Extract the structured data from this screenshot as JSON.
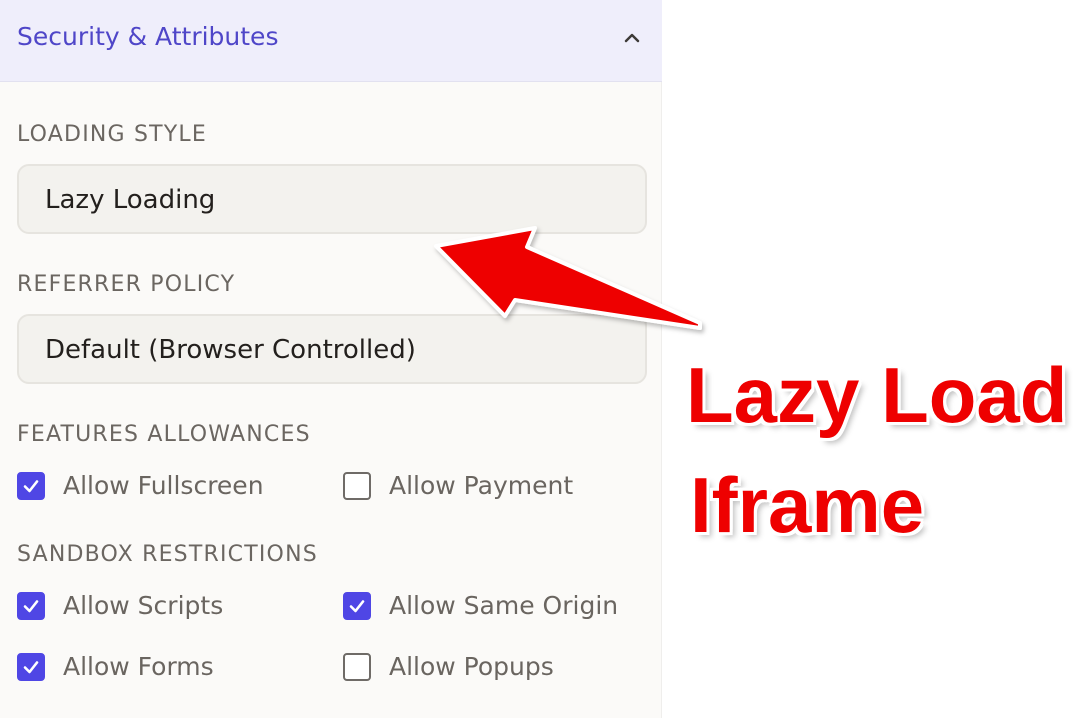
{
  "panel": {
    "title": "Security & Attributes",
    "collapse_icon": "chevron-up-icon"
  },
  "loading_style": {
    "label": "LOADING STYLE",
    "value": "Lazy Loading"
  },
  "referrer_policy": {
    "label": "REFERRER POLICY",
    "value": "Default (Browser Controlled)"
  },
  "features": {
    "label": "FEATURES ALLOWANCES",
    "items": [
      {
        "label": "Allow Fullscreen",
        "checked": true
      },
      {
        "label": "Allow Payment",
        "checked": false
      }
    ]
  },
  "sandbox": {
    "label": "SANDBOX RESTRICTIONS",
    "items": [
      {
        "label": "Allow Scripts",
        "checked": true
      },
      {
        "label": "Allow Same Origin",
        "checked": true
      },
      {
        "label": "Allow Forms",
        "checked": true
      },
      {
        "label": "Allow Popups",
        "checked": false
      }
    ]
  },
  "annotation": {
    "line1": "Lazy Load",
    "line2": "Iframe",
    "color": "#ee0000"
  },
  "colors": {
    "accent": "#4f46e5",
    "header_bg": "#efeefb",
    "title": "#4f46c8"
  }
}
